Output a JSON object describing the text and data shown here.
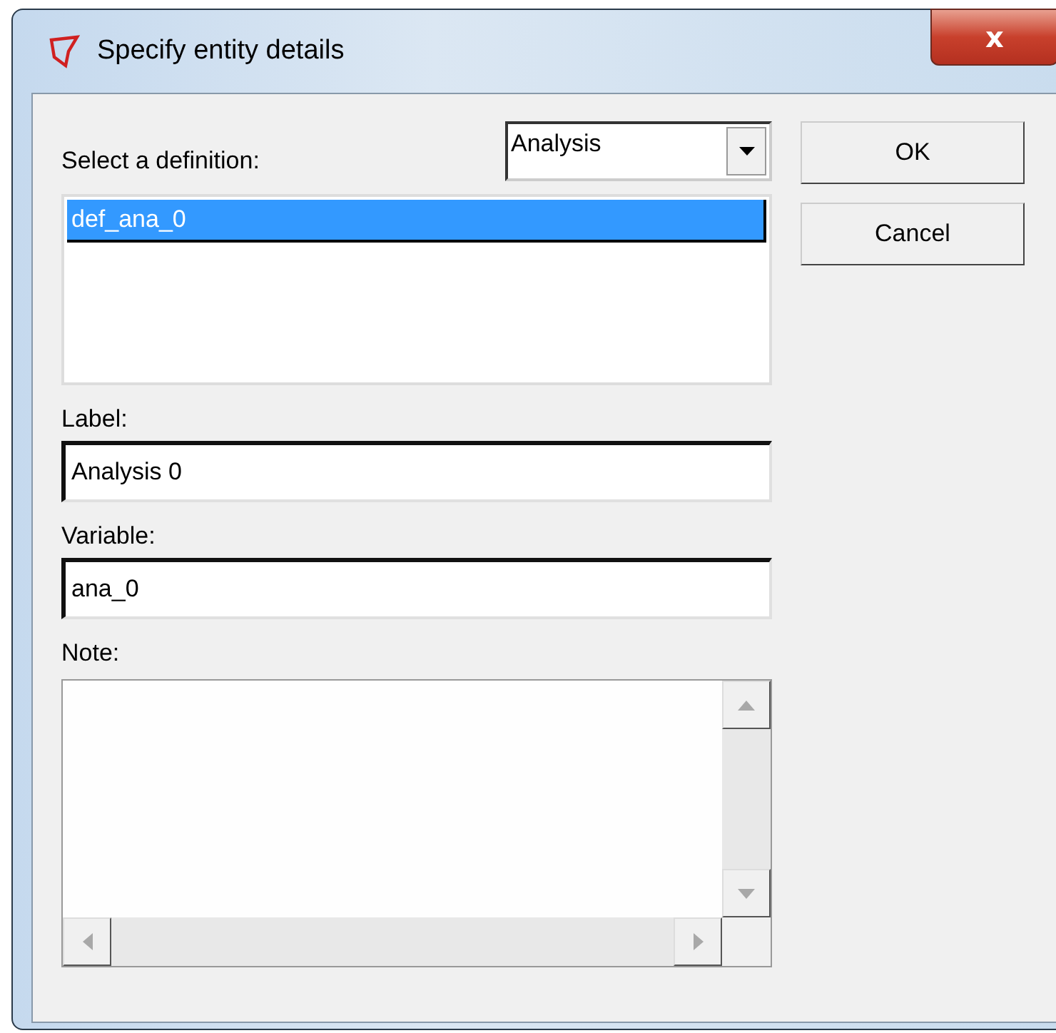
{
  "window": {
    "title": "Specify entity details",
    "close": "x"
  },
  "definition": {
    "label": "Select a definition:",
    "dropdown": "Analysis",
    "items": [
      {
        "text": "def_ana_0",
        "selected": true
      }
    ]
  },
  "buttons": [
    "OK",
    "Cancel"
  ],
  "fields": [
    {
      "label": "Label:",
      "value": "Analysis 0"
    },
    {
      "label": "Variable:",
      "value": "ana_0"
    }
  ],
  "note": {
    "label": "Note:"
  }
}
